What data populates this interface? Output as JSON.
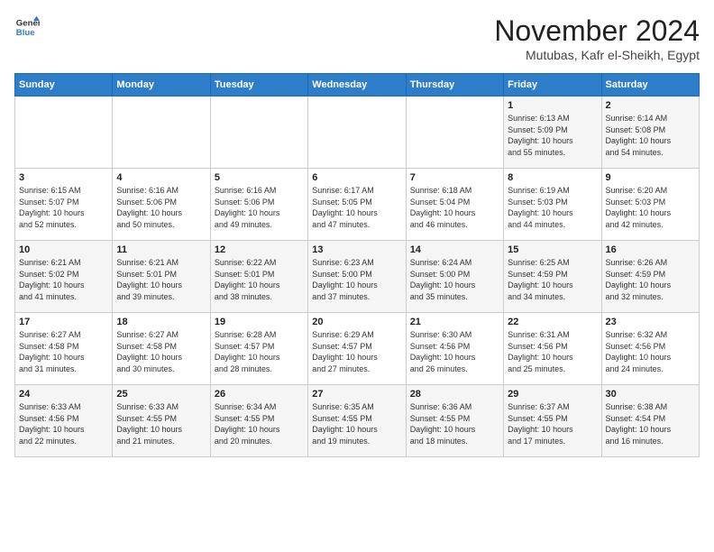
{
  "logo": {
    "line1": "General",
    "line2": "Blue"
  },
  "title": "November 2024",
  "subtitle": "Mutubas, Kafr el-Sheikh, Egypt",
  "days_of_week": [
    "Sunday",
    "Monday",
    "Tuesday",
    "Wednesday",
    "Thursday",
    "Friday",
    "Saturday"
  ],
  "weeks": [
    [
      {
        "day": "",
        "info": ""
      },
      {
        "day": "",
        "info": ""
      },
      {
        "day": "",
        "info": ""
      },
      {
        "day": "",
        "info": ""
      },
      {
        "day": "",
        "info": ""
      },
      {
        "day": "1",
        "info": "Sunrise: 6:13 AM\nSunset: 5:09 PM\nDaylight: 10 hours\nand 55 minutes."
      },
      {
        "day": "2",
        "info": "Sunrise: 6:14 AM\nSunset: 5:08 PM\nDaylight: 10 hours\nand 54 minutes."
      }
    ],
    [
      {
        "day": "3",
        "info": "Sunrise: 6:15 AM\nSunset: 5:07 PM\nDaylight: 10 hours\nand 52 minutes."
      },
      {
        "day": "4",
        "info": "Sunrise: 6:16 AM\nSunset: 5:06 PM\nDaylight: 10 hours\nand 50 minutes."
      },
      {
        "day": "5",
        "info": "Sunrise: 6:16 AM\nSunset: 5:06 PM\nDaylight: 10 hours\nand 49 minutes."
      },
      {
        "day": "6",
        "info": "Sunrise: 6:17 AM\nSunset: 5:05 PM\nDaylight: 10 hours\nand 47 minutes."
      },
      {
        "day": "7",
        "info": "Sunrise: 6:18 AM\nSunset: 5:04 PM\nDaylight: 10 hours\nand 46 minutes."
      },
      {
        "day": "8",
        "info": "Sunrise: 6:19 AM\nSunset: 5:03 PM\nDaylight: 10 hours\nand 44 minutes."
      },
      {
        "day": "9",
        "info": "Sunrise: 6:20 AM\nSunset: 5:03 PM\nDaylight: 10 hours\nand 42 minutes."
      }
    ],
    [
      {
        "day": "10",
        "info": "Sunrise: 6:21 AM\nSunset: 5:02 PM\nDaylight: 10 hours\nand 41 minutes."
      },
      {
        "day": "11",
        "info": "Sunrise: 6:21 AM\nSunset: 5:01 PM\nDaylight: 10 hours\nand 39 minutes."
      },
      {
        "day": "12",
        "info": "Sunrise: 6:22 AM\nSunset: 5:01 PM\nDaylight: 10 hours\nand 38 minutes."
      },
      {
        "day": "13",
        "info": "Sunrise: 6:23 AM\nSunset: 5:00 PM\nDaylight: 10 hours\nand 37 minutes."
      },
      {
        "day": "14",
        "info": "Sunrise: 6:24 AM\nSunset: 5:00 PM\nDaylight: 10 hours\nand 35 minutes."
      },
      {
        "day": "15",
        "info": "Sunrise: 6:25 AM\nSunset: 4:59 PM\nDaylight: 10 hours\nand 34 minutes."
      },
      {
        "day": "16",
        "info": "Sunrise: 6:26 AM\nSunset: 4:59 PM\nDaylight: 10 hours\nand 32 minutes."
      }
    ],
    [
      {
        "day": "17",
        "info": "Sunrise: 6:27 AM\nSunset: 4:58 PM\nDaylight: 10 hours\nand 31 minutes."
      },
      {
        "day": "18",
        "info": "Sunrise: 6:27 AM\nSunset: 4:58 PM\nDaylight: 10 hours\nand 30 minutes."
      },
      {
        "day": "19",
        "info": "Sunrise: 6:28 AM\nSunset: 4:57 PM\nDaylight: 10 hours\nand 28 minutes."
      },
      {
        "day": "20",
        "info": "Sunrise: 6:29 AM\nSunset: 4:57 PM\nDaylight: 10 hours\nand 27 minutes."
      },
      {
        "day": "21",
        "info": "Sunrise: 6:30 AM\nSunset: 4:56 PM\nDaylight: 10 hours\nand 26 minutes."
      },
      {
        "day": "22",
        "info": "Sunrise: 6:31 AM\nSunset: 4:56 PM\nDaylight: 10 hours\nand 25 minutes."
      },
      {
        "day": "23",
        "info": "Sunrise: 6:32 AM\nSunset: 4:56 PM\nDaylight: 10 hours\nand 24 minutes."
      }
    ],
    [
      {
        "day": "24",
        "info": "Sunrise: 6:33 AM\nSunset: 4:56 PM\nDaylight: 10 hours\nand 22 minutes."
      },
      {
        "day": "25",
        "info": "Sunrise: 6:33 AM\nSunset: 4:55 PM\nDaylight: 10 hours\nand 21 minutes."
      },
      {
        "day": "26",
        "info": "Sunrise: 6:34 AM\nSunset: 4:55 PM\nDaylight: 10 hours\nand 20 minutes."
      },
      {
        "day": "27",
        "info": "Sunrise: 6:35 AM\nSunset: 4:55 PM\nDaylight: 10 hours\nand 19 minutes."
      },
      {
        "day": "28",
        "info": "Sunrise: 6:36 AM\nSunset: 4:55 PM\nDaylight: 10 hours\nand 18 minutes."
      },
      {
        "day": "29",
        "info": "Sunrise: 6:37 AM\nSunset: 4:55 PM\nDaylight: 10 hours\nand 17 minutes."
      },
      {
        "day": "30",
        "info": "Sunrise: 6:38 AM\nSunset: 4:54 PM\nDaylight: 10 hours\nand 16 minutes."
      }
    ]
  ]
}
